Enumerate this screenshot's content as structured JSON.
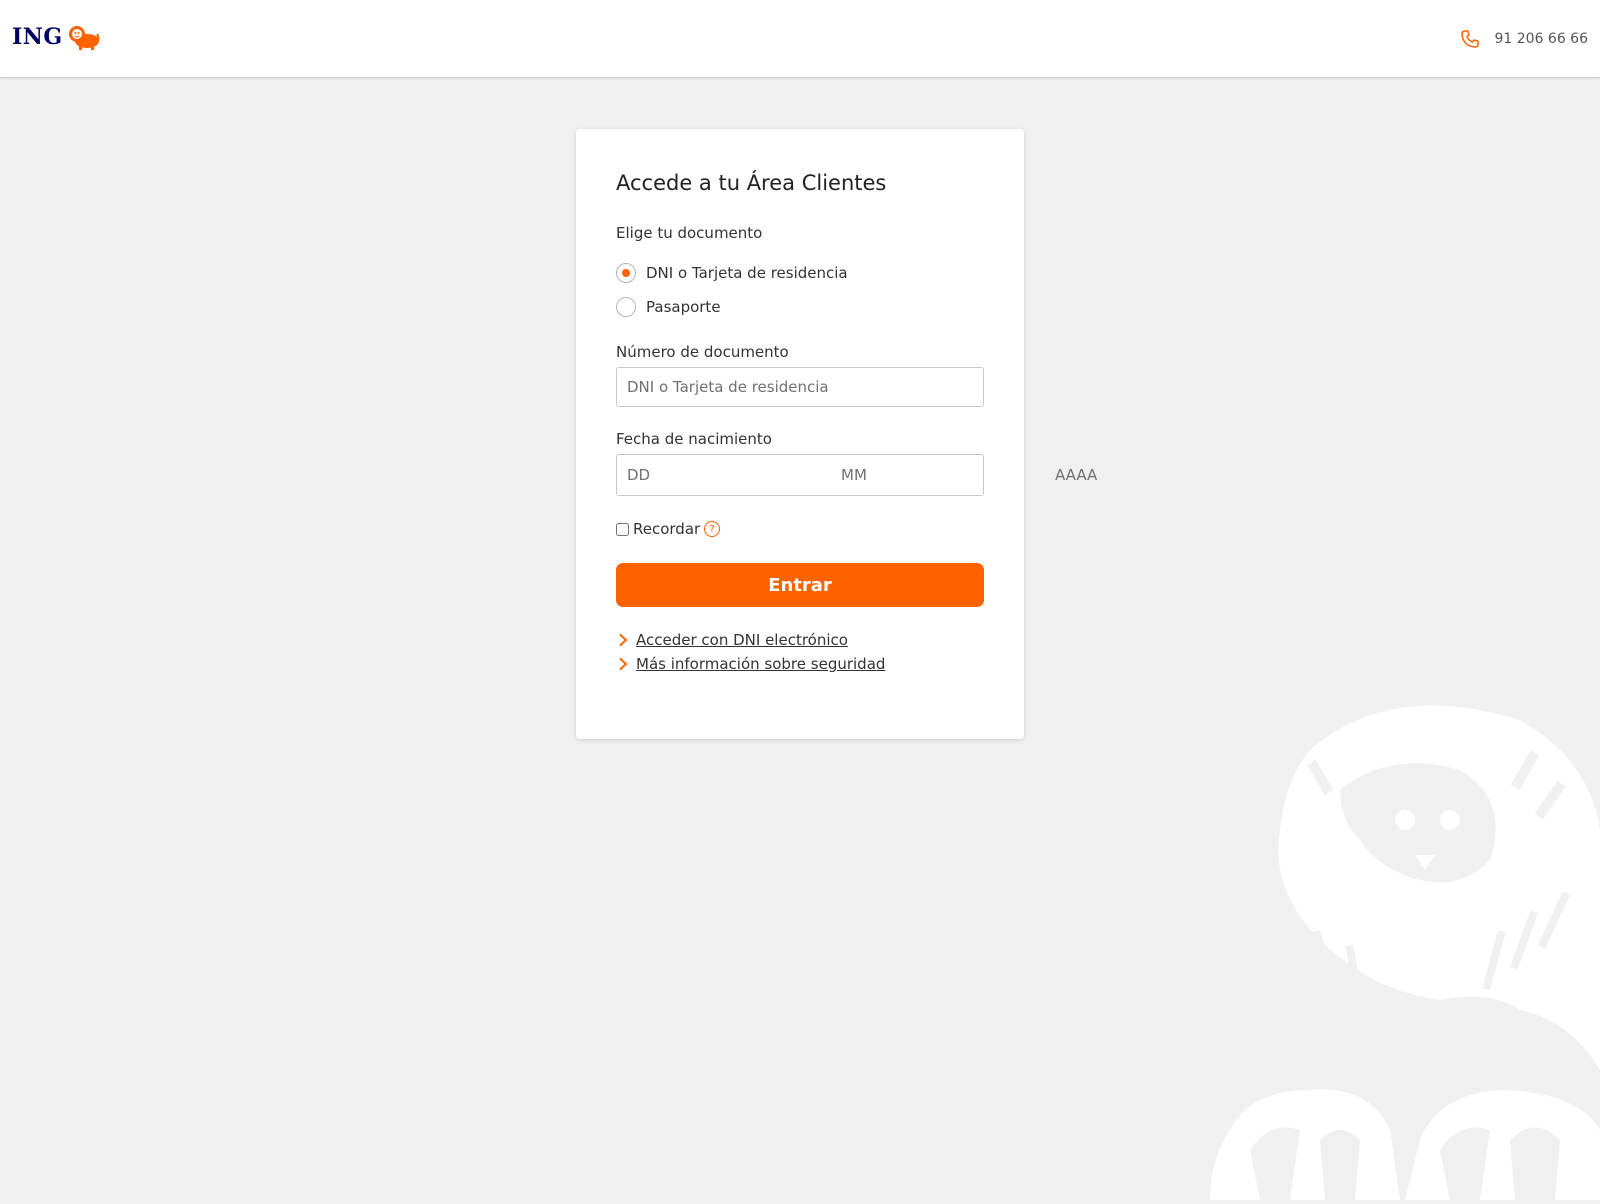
{
  "header": {
    "logo_text": "ING",
    "phone": "91 206 66 66"
  },
  "colors": {
    "accent": "#ff6200",
    "brand_navy": "#000066",
    "page_background": "#f0f0f0"
  },
  "icons": {
    "logo": "ing-lion-logo-icon",
    "phone": "phone-icon",
    "help": "question-mark-circle-icon",
    "link_chevron": "chevron-right-icon",
    "watermark": "ing-lion-watermark-icon"
  },
  "login": {
    "title": "Accede a tu Área Clientes",
    "document_label": "Elige tu documento",
    "document_options": [
      {
        "label": "DNI o Tarjeta de residencia",
        "selected": true
      },
      {
        "label": "Pasaporte",
        "selected": false
      }
    ],
    "number_label": "Número de documento",
    "number_placeholder": "DNI o Tarjeta de residencia",
    "birthdate_label": "Fecha de nacimiento",
    "birthdate_placeholders": {
      "day": "DD",
      "month": "MM",
      "year": "AAAA"
    },
    "remember_label": "Recordar",
    "remember_checked": false,
    "help_glyph": "?",
    "submit_label": "Entrar",
    "links": [
      "Acceder con DNI electrónico",
      "Más información sobre seguridad"
    ]
  }
}
